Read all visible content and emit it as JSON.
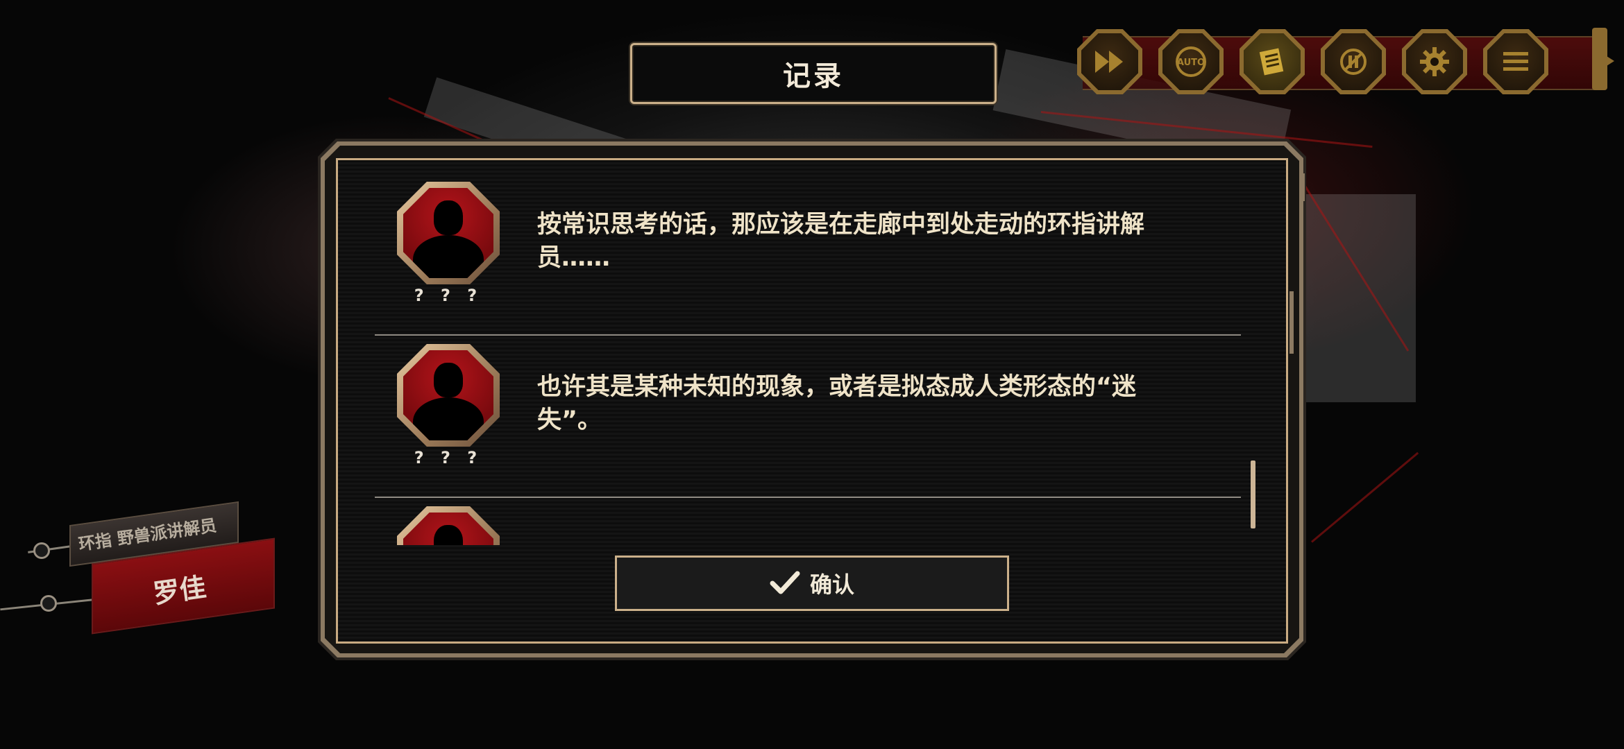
{
  "title": "记录",
  "toolbar": {
    "buttons": [
      {
        "name": "fast-forward",
        "icon": "fast-forward-icon"
      },
      {
        "name": "auto",
        "icon": "auto-icon",
        "label": "AUTO"
      },
      {
        "name": "log",
        "icon": "log-icon"
      },
      {
        "name": "hide-ui",
        "icon": "hide-ui-icon"
      },
      {
        "name": "settings",
        "icon": "gear-icon"
      },
      {
        "name": "menu",
        "icon": "menu-icon"
      }
    ]
  },
  "log": {
    "entries": [
      {
        "speaker": "? ? ?",
        "text": "按常识思考的话，那应该是在走廊中到处走动的环指讲解员……"
      },
      {
        "speaker": "? ? ?",
        "text": "也许其是某种未知的现象，或者是拟态成人类形态的“迷失”。"
      },
      {
        "speaker": "",
        "text": ""
      }
    ]
  },
  "confirm": {
    "label": "确认",
    "icon": "check-icon"
  },
  "nameplate": {
    "title": "环指 野兽派讲解员",
    "name": "罗佳"
  },
  "colors": {
    "accent_gold": "#cbb08a",
    "avatar_red": "#b3141a",
    "text_cream": "#efe3c8"
  }
}
